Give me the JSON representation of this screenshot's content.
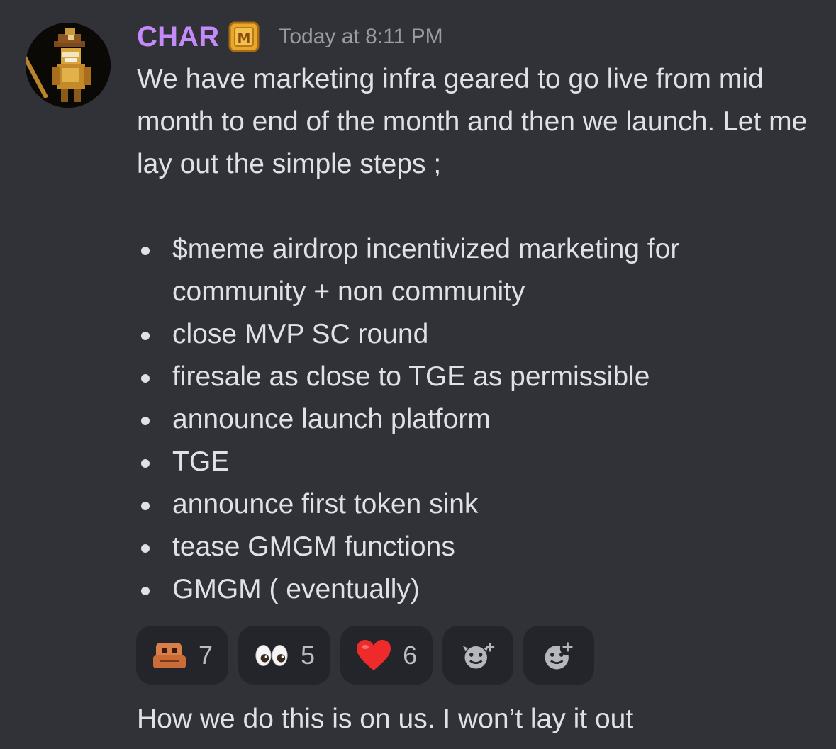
{
  "message": {
    "author": "CHAR",
    "role_badge_letter": "M",
    "timestamp": "Today at 8:11 PM",
    "body": "We have marketing infra geared to go live from mid month to end of the month and then we launch.  Let me lay out the simple steps ;",
    "bullets": [
      "$meme airdrop incentivized marketing for community + non community",
      "close MVP SC round",
      "firesale as close to TGE as permissible",
      "announce launch platform",
      "TGE",
      "announce first token sink",
      "tease GMGM functions",
      "GMGM ( eventually)"
    ]
  },
  "reactions": [
    {
      "emoji": "custom-frog-emoji",
      "count": "7"
    },
    {
      "emoji": "eyes-emoji",
      "count": "5"
    },
    {
      "emoji": "red-heart-emoji",
      "count": "6"
    }
  ],
  "reaction_actions": [
    {
      "icon": "add-super-reaction-icon"
    },
    {
      "icon": "add-reaction-icon"
    }
  ],
  "next_message": {
    "body": "How we do this is on us. I won’t lay it out"
  },
  "colors": {
    "background": "#313238",
    "username": "#c58af9",
    "text": "#dfe1e5",
    "timestamp": "#9a9ca3",
    "reaction_bg": "#24252a"
  }
}
